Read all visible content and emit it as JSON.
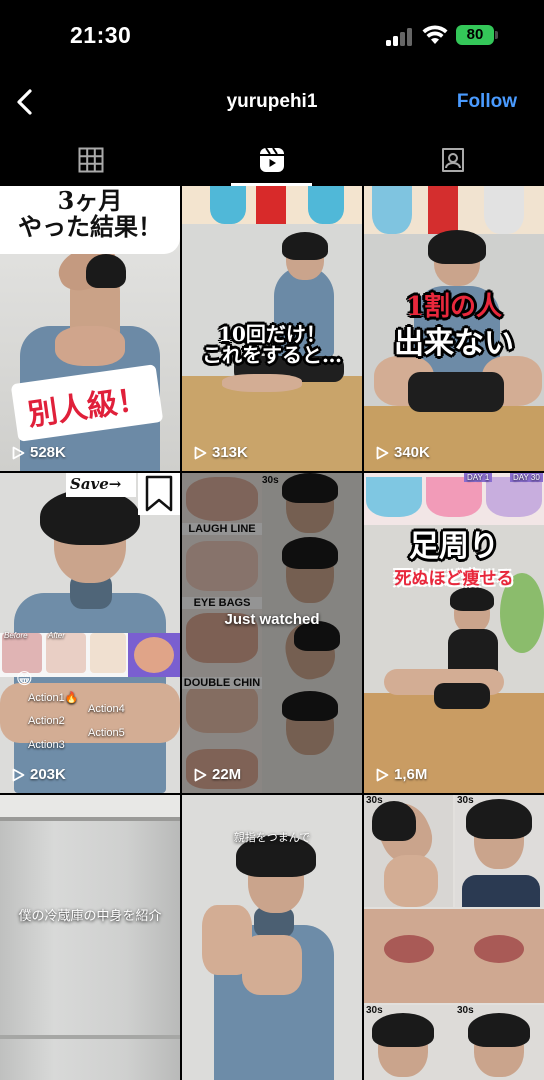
{
  "status": {
    "time": "21:30",
    "battery": "80"
  },
  "header": {
    "username": "yurupehi1",
    "follow_label": "Follow"
  },
  "tabs": [
    {
      "name": "grid",
      "icon": "grid-icon"
    },
    {
      "name": "reels",
      "icon": "reels-icon",
      "active": true
    },
    {
      "name": "tagged",
      "icon": "tagged-icon"
    }
  ],
  "tiles": [
    {
      "views": "528K",
      "caption_top": "3ヶ月\nやった結果！",
      "caption_bottom": "別人級！"
    },
    {
      "views": "313K",
      "caption": "10回だけ！\nこれをすると…"
    },
    {
      "views": "340K",
      "caption_line1": "1割の人",
      "caption_line2": "出来ない"
    },
    {
      "views": "203K",
      "save_label": "Save→",
      "labels": [
        "Action1🔥",
        "Action2",
        "Action3",
        "Action4",
        "Action5"
      ],
      "before": "Before",
      "after": "After"
    },
    {
      "views": "22M",
      "overlay": "Just watched",
      "labels": [
        "LAUGH LINE",
        "EYE BAGS",
        "DOUBLE CHIN"
      ],
      "timer": "30s"
    },
    {
      "views": "1,6M",
      "caption_line1": "足周り",
      "caption_line2": "死ぬほど痩せる",
      "day1": "DAY 1",
      "day30": "DAY 30"
    },
    {
      "caption": "僕の冷蔵庫の中身を紹介"
    },
    {
      "caption": "親指をつまんで"
    },
    {
      "timer": "30s"
    }
  ]
}
